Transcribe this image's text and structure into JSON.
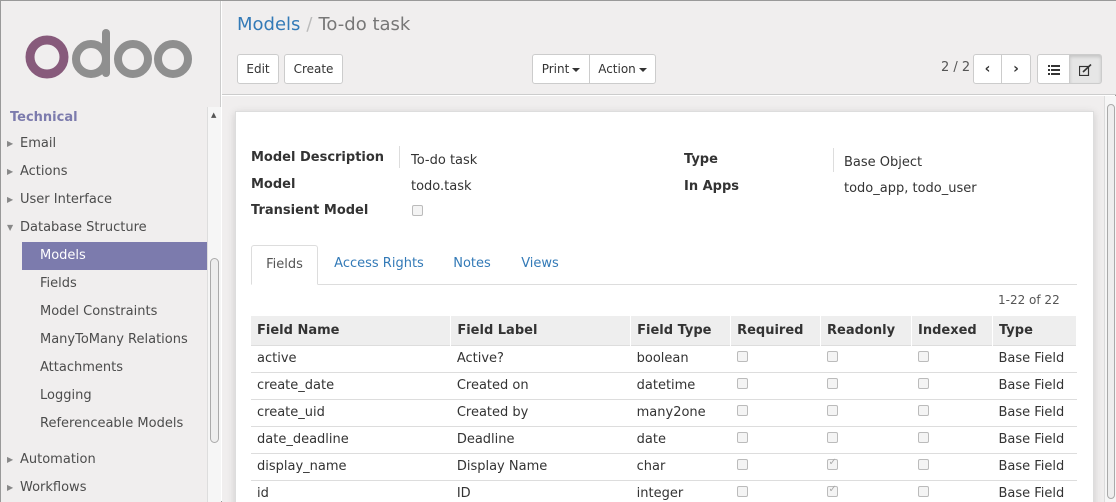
{
  "sidebar": {
    "logo": "odoo",
    "section_title": "Technical",
    "items": [
      {
        "label": "Email",
        "expanded": false
      },
      {
        "label": "Actions",
        "expanded": false
      },
      {
        "label": "User Interface",
        "expanded": false
      },
      {
        "label": "Database Structure",
        "expanded": true
      }
    ],
    "sub_items": [
      "Models",
      "Fields",
      "Model Constraints",
      "ManyToMany Relations",
      "Attachments",
      "Logging",
      "Referenceable Models"
    ],
    "active_sub": "Models",
    "after_items": [
      "Automation",
      "Workflows"
    ]
  },
  "header": {
    "breadcrumb_root": "Models",
    "breadcrumb_sep": "/",
    "breadcrumb_current": "To-do task",
    "edit_label": "Edit",
    "create_label": "Create",
    "print_label": "Print",
    "action_label": "Action",
    "pager": "2 / 2"
  },
  "form": {
    "model_description_label": "Model Description",
    "model_description_value": "To-do task",
    "model_label": "Model",
    "model_value": "todo.task",
    "transient_label": "Transient Model",
    "type_label": "Type",
    "type_value": "Base Object",
    "in_apps_label": "In Apps",
    "in_apps_value": "todo_app, todo_user"
  },
  "tabs": [
    "Fields",
    "Access Rights",
    "Notes",
    "Views"
  ],
  "active_tab": "Fields",
  "list": {
    "count": "1-22 of 22",
    "columns": [
      "Field Name",
      "Field Label",
      "Field Type",
      "Required",
      "Readonly",
      "Indexed",
      "Type"
    ],
    "rows": [
      {
        "name": "active",
        "label": "Active?",
        "type": "boolean",
        "required": false,
        "readonly": false,
        "indexed": false,
        "kind": "Base Field"
      },
      {
        "name": "create_date",
        "label": "Created on",
        "type": "datetime",
        "required": false,
        "readonly": false,
        "indexed": false,
        "kind": "Base Field"
      },
      {
        "name": "create_uid",
        "label": "Created by",
        "type": "many2one",
        "required": false,
        "readonly": false,
        "indexed": false,
        "kind": "Base Field"
      },
      {
        "name": "date_deadline",
        "label": "Deadline",
        "type": "date",
        "required": false,
        "readonly": false,
        "indexed": false,
        "kind": "Base Field"
      },
      {
        "name": "display_name",
        "label": "Display Name",
        "type": "char",
        "required": false,
        "readonly": true,
        "indexed": false,
        "kind": "Base Field"
      },
      {
        "name": "id",
        "label": "ID",
        "type": "integer",
        "required": false,
        "readonly": true,
        "indexed": false,
        "kind": "Base Field"
      }
    ]
  },
  "colors": {
    "accent": "#7c7bad",
    "logo_o": "#875a7b",
    "logo_rest": "#8f8f8f",
    "link": "#337ab7"
  }
}
